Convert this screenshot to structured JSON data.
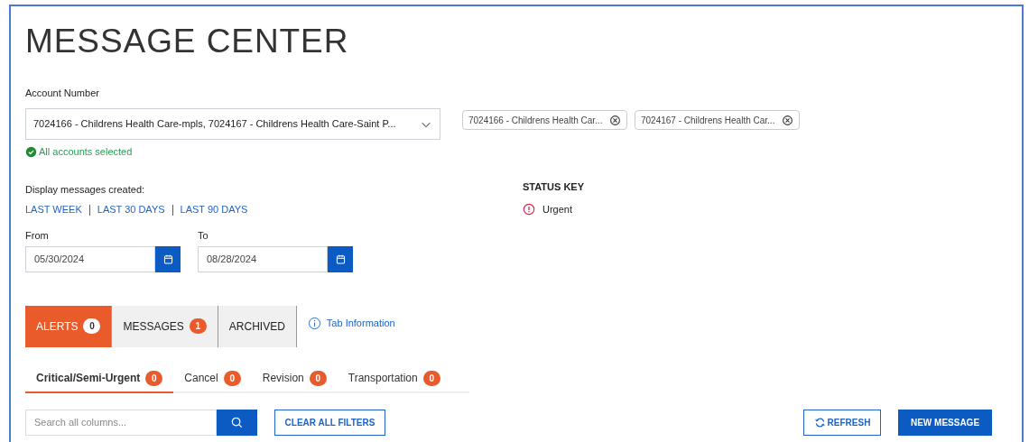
{
  "title": "MESSAGE CENTER",
  "account": {
    "label": "Account Number",
    "value": "7024166 - Childrens Health Care-mpls, 7024167 - Childrens Health Care-Saint P...",
    "status": "All accounts selected",
    "chips": [
      "7024166 - Childrens Health Car...",
      "7024167 - Childrens Health Car..."
    ]
  },
  "date_filter": {
    "label": "Display messages created:",
    "quick_links": [
      "LAST WEEK",
      "LAST 30 DAYS",
      "LAST 90 DAYS"
    ],
    "from": {
      "label": "From",
      "value": "05/30/2024"
    },
    "to": {
      "label": "To",
      "value": "08/28/2024"
    }
  },
  "status_key": {
    "title": "STATUS KEY",
    "items": [
      "Urgent"
    ]
  },
  "tabs": [
    {
      "label": "ALERTS",
      "count": "0",
      "selected": true
    },
    {
      "label": "MESSAGES",
      "count": "1",
      "selected": false
    },
    {
      "label": "ARCHIVED",
      "selected": false
    }
  ],
  "tab_info": "Tab Information",
  "sub_tabs": [
    {
      "label": "Critical/Semi-Urgent",
      "count": "0",
      "selected": true
    },
    {
      "label": "Cancel",
      "count": "0",
      "selected": false
    },
    {
      "label": "Revision",
      "count": "0",
      "selected": false
    },
    {
      "label": "Transportation",
      "count": "0",
      "selected": false
    }
  ],
  "search": {
    "placeholder": "Search all columns..."
  },
  "buttons": {
    "clear": "CLEAR ALL FILTERS",
    "refresh": "REFRESH",
    "new": "NEW MESSAGE"
  }
}
